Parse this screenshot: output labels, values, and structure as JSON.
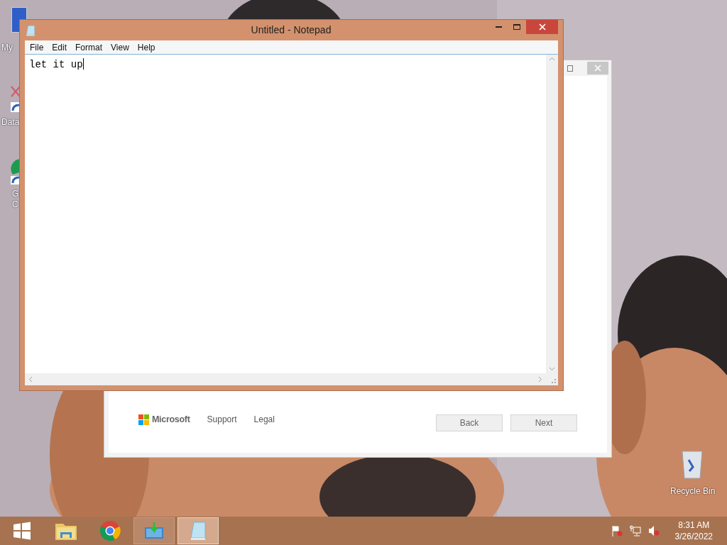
{
  "desktop": {
    "icons": [
      {
        "lines": [
          "My"
        ]
      },
      {
        "lines": [
          "Data"
        ]
      },
      {
        "lines": [
          "G",
          "C"
        ]
      }
    ],
    "recycle_bin": {
      "label": "Recycle Bin"
    }
  },
  "background_window": {
    "logo": "Microsoft",
    "links": [
      "Support",
      "Legal"
    ],
    "buttons": [
      "Back",
      "Next"
    ]
  },
  "notepad": {
    "title": "Untitled - Notepad",
    "menu": [
      "File",
      "Edit",
      "Format",
      "View",
      "Help"
    ],
    "text": "let it up"
  },
  "taskbar": {
    "apps": [
      {
        "kind": "start",
        "open": false,
        "selected": false
      },
      {
        "kind": "explorer",
        "open": false,
        "selected": false
      },
      {
        "kind": "chrome",
        "open": false,
        "selected": false
      },
      {
        "kind": "setup",
        "open": true,
        "selected": false
      },
      {
        "kind": "notepad",
        "open": true,
        "selected": true
      }
    ],
    "clock": {
      "time": "8:31 AM",
      "date": "3/26/2022"
    }
  }
}
